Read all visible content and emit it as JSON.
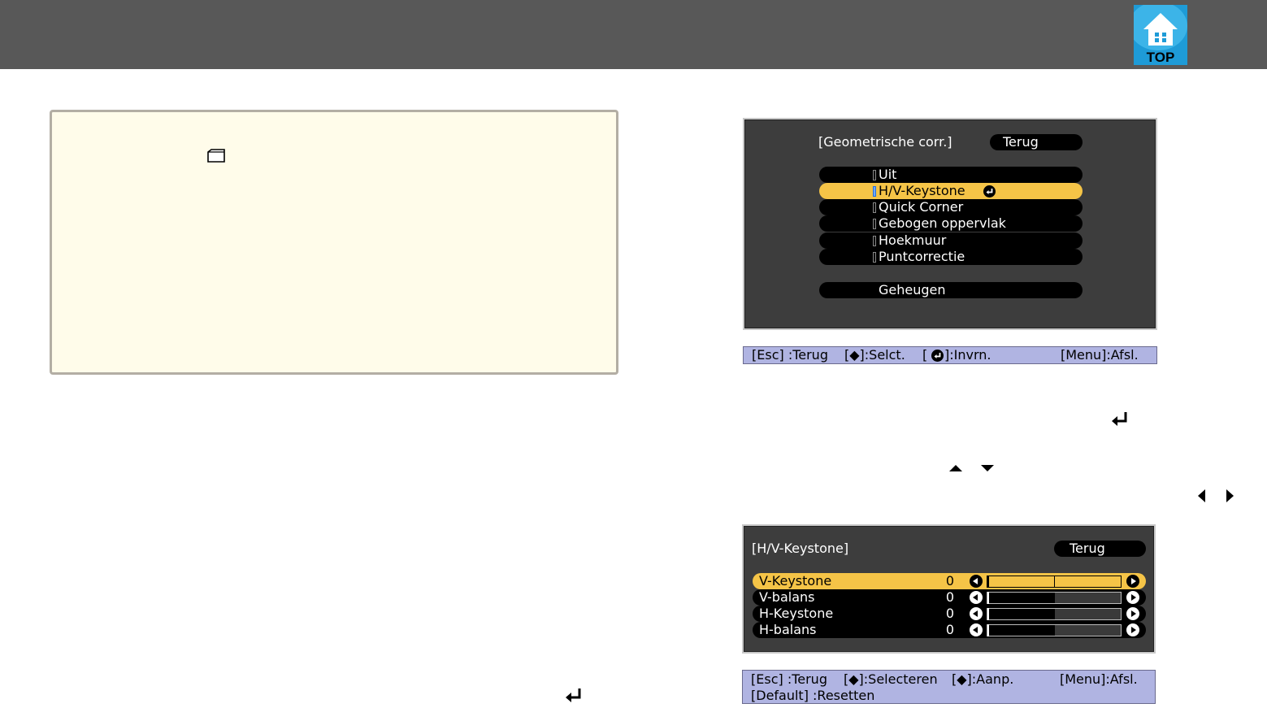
{
  "header": {
    "logo_text": "TOP"
  },
  "menu1": {
    "title": "[Geometrische corr.]",
    "back": "Terug",
    "items": [
      {
        "label": "Uit"
      },
      {
        "label": "H/V-Keystone",
        "selected": true
      },
      {
        "label": "Quick Corner"
      },
      {
        "label": "Gebogen oppervlak"
      },
      {
        "label": "Hoekmuur"
      },
      {
        "label": "Puntcorrectie"
      }
    ],
    "memory": "Geheugen",
    "status": {
      "esc": "[Esc] :Terug",
      "select": "[◆]:Selct.",
      "enter": "[",
      "enter2": "]:Invrn.",
      "menu": "[Menu]:Afsl."
    }
  },
  "menu2": {
    "title": "[H/V-Keystone]",
    "back": "Terug",
    "rows": [
      {
        "label": "V-Keystone",
        "value": "0",
        "level": 0.5,
        "selected": true
      },
      {
        "label": "V-balans",
        "value": "0",
        "level": 0.5
      },
      {
        "label": "H-Keystone",
        "value": "0",
        "level": 0.5
      },
      {
        "label": "H-balans",
        "value": "0",
        "level": 0.5
      }
    ],
    "status": {
      "line1_esc": "[Esc] :Terug",
      "line1_select": "[◆]:Selecteren",
      "line1_adjust": "[◆]:Aanp.",
      "line1_menu": "[Menu]:Afsl.",
      "line2": "[Default] :Resetten"
    }
  },
  "colors": {
    "header": "#585858",
    "highlight": "#f5c447",
    "status_bar": "#b0b4e2",
    "note_bg": "#fffcea",
    "osd_bg": "#3d3d3d"
  }
}
